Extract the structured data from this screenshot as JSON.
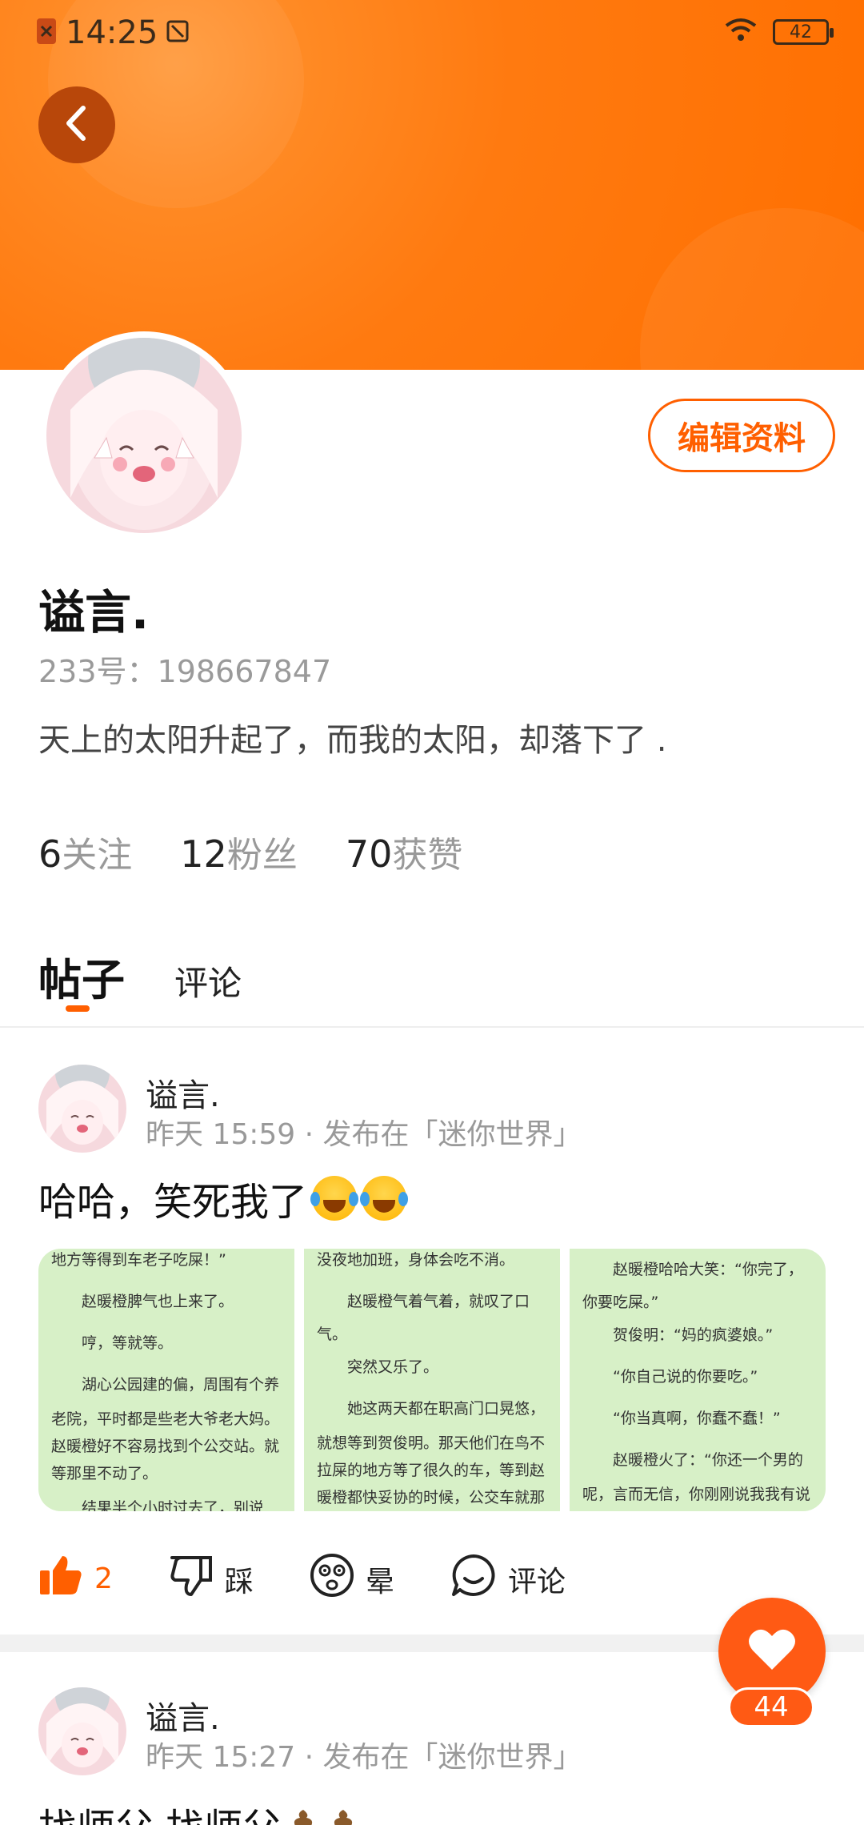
{
  "status_bar": {
    "time": "14:25",
    "battery": "42"
  },
  "profile": {
    "edit_button": "编辑资料",
    "name": "谥言.",
    "uid": "233号：198667847",
    "bio": "天上的太阳升起了，而我的太阳，却落下了 .",
    "stats": [
      {
        "num": "6",
        "label": "关注"
      },
      {
        "num": "12",
        "label": "粉丝"
      },
      {
        "num": "70",
        "label": "获赞"
      }
    ]
  },
  "tabs": {
    "active": "帖子",
    "other": "评论"
  },
  "posts": [
    {
      "author": "谥言.",
      "meta": "昨天 15:59 · 发布在「迷你世界」",
      "text": "哈哈，笑死我了",
      "images": [
        [
          "地方等得到车老子吃屎！”",
          "　　赵暖橙脾气也上来了。",
          "　　哼，等就等。",
          "　　湖心公园建的偏，周围有个养",
          "老院，平时都是些老大爷老大妈。",
          "赵暖橙好不容易找到个公交站。就",
          "等那里不动了。",
          "　　结果半个小时过去了，别说"
        ],
        [
          "没夜地加班，身体会吃不消。",
          "　　赵暖橙气着气着，就叹了口",
          "气。",
          "　　突然又乐了。",
          "　　她这两天都在职高门口晃悠，",
          "就想等到贺俊明。那天他们在鸟不",
          "拉屎的地方等了很久的车，等到赵",
          "暖橙都快妥协的时候，公交车就那"
        ],
        [
          "　　赵暖橙哈哈大笑：“你完了，",
          "你要吃屎。”",
          "　　贺俊明：“妈的疯婆娘。”",
          "　　“你自己说的你要吃。”",
          "　　“你当真啊，你蠢不蠢！”",
          "　　赵暖橙火了：“你还一个男的",
          "呢，言而无信，你刚刚说我我有说"
        ]
      ],
      "actions": {
        "like_count": "2",
        "dislike": "踩",
        "dizzy": "晕",
        "comment": "评论"
      }
    },
    {
      "author": "谥言.",
      "meta": "昨天 15:27 · 发布在「迷你世界」",
      "text": "找师父  找师父"
    }
  ],
  "fab": {
    "count": "44"
  },
  "colors": {
    "accent": "#ff5f00",
    "banner": "#ff7a10",
    "image_bg": "#d7f0c7"
  },
  "icons": [
    "back-arrow-icon",
    "wifi-icon",
    "battery-icon",
    "thumbs-up-icon",
    "thumbs-down-icon",
    "dizzy-face-icon",
    "comment-icon",
    "heart-icon",
    "laughing-crying-emoji",
    "poop-emoji"
  ]
}
